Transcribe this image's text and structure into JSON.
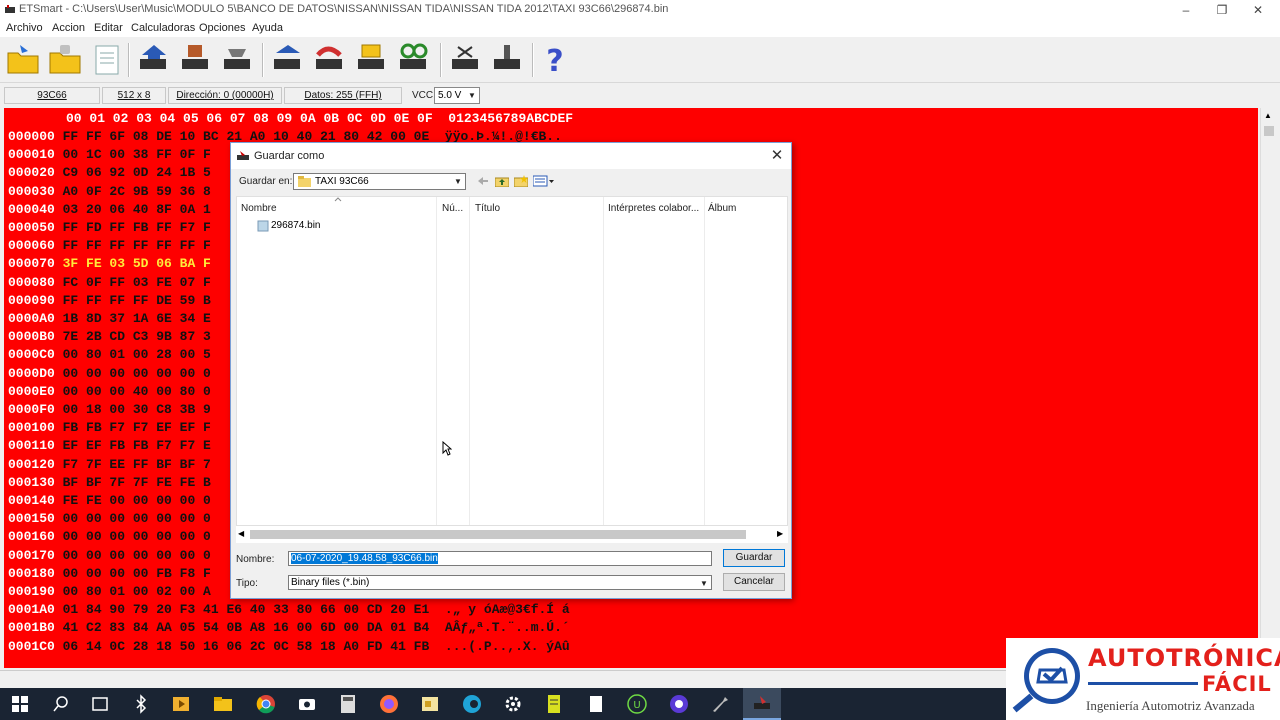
{
  "window": {
    "title": "ETSmart - C:\\Users\\User\\Music\\MODULO 5\\BANCO DE DATOS\\NISSAN\\NISSAN TIDA\\NISSAN TIDA 2012\\TAXI 93C66\\296874.bin"
  },
  "menu": [
    "Archivo",
    "Accion",
    "Editar",
    "Calculadoras",
    "Opciones",
    "Ayuda"
  ],
  "toolbar_icons": [
    "open-icon",
    "open-lock-icon",
    "document-icon",
    "chip-read-icon",
    "chip-write-icon",
    "chip-erase-icon",
    "chip-verify-icon",
    "chip-undo-icon",
    "chip-compare-icon",
    "chip-search-icon",
    "chip-blank-icon",
    "chip-cut-icon",
    "help-icon"
  ],
  "infobar": {
    "chip": "93C66",
    "size": "512 x 8",
    "address": "Dirección: 0 (00000H)",
    "data": "Datos: 255 (FFH)",
    "vcc_label": "VCC",
    "vcc_value": "5.0 V"
  },
  "hex": {
    "header": "00 01 02 03 04 05 06 07 08 09 0A 0B 0C 0D 0E 0F  0123456789ABCDEF",
    "rows": [
      {
        "addr": "000000",
        "bytes": "FF FF 6F 08 DE 10 BC 21 A0 10 40 21 80 42 00 0E  ÿÿo.Þ.¼!.@!€B.."
      },
      {
        "addr": "000010",
        "bytes": "00 1C 00 38 FF 0F F"
      },
      {
        "addr": "000020",
        "bytes": "C9 06 92 0D 24 1B 5"
      },
      {
        "addr": "000030",
        "bytes": "A0 0F 2C 9B 59 36 8"
      },
      {
        "addr": "000040",
        "bytes": "03 20 06 40 8F 0A 1"
      },
      {
        "addr": "000050",
        "bytes": "FF FD FF FB FF F7 F"
      },
      {
        "addr": "000060",
        "bytes": "FF FF FF FF FF FF F"
      },
      {
        "addr": "000070",
        "bytes": "3F FE 03 5D 06 BA F"
      },
      {
        "addr": "000080",
        "bytes": "FC 0F FF 03 FE 07 F"
      },
      {
        "addr": "000090",
        "bytes": "FF FF FF FF DE 59 B"
      },
      {
        "addr": "0000A0",
        "bytes": "1B 8D 37 1A 6E 34 E"
      },
      {
        "addr": "0000B0",
        "bytes": "7E 2B CD C3 9B 87 3"
      },
      {
        "addr": "0000C0",
        "bytes": "00 80 01 00 28 00 5"
      },
      {
        "addr": "0000D0",
        "bytes": "00 00 00 00 00 00 0"
      },
      {
        "addr": "0000E0",
        "bytes": "00 00 00 40 00 80 0"
      },
      {
        "addr": "0000F0",
        "bytes": "00 18 00 30 C8 3B 9"
      },
      {
        "addr": "000100",
        "bytes": "FB FB F7 F7 EF EF F"
      },
      {
        "addr": "000110",
        "bytes": "EF EF FB FB F7 F7 E"
      },
      {
        "addr": "000120",
        "bytes": "F7 7F EE FF BF BF 7"
      },
      {
        "addr": "000130",
        "bytes": "BF BF 7F 7F FE FE B"
      },
      {
        "addr": "000140",
        "bytes": "FE FE 00 00 00 00 0"
      },
      {
        "addr": "000150",
        "bytes": "00 00 00 00 00 00 0"
      },
      {
        "addr": "000160",
        "bytes": "00 00 00 00 00 00 0"
      },
      {
        "addr": "000170",
        "bytes": "00 00 00 00 00 00 0"
      },
      {
        "addr": "000180",
        "bytes": "00 00 00 00 FB F8 F"
      },
      {
        "addr": "000190",
        "bytes": "00 80 01 00 02 00 A"
      },
      {
        "addr": "0001A0",
        "bytes": "01 84 90 79 20 F3 41 E6 40 33 80 66 00 CD 20 E1  .„ y óAæ@3€f.Í á"
      },
      {
        "addr": "0001B0",
        "bytes": "41 C2 83 84 AA 05 54 0B A8 16 00 6D 00 DA 01 B4  AÂƒ„ª.T.¨..m.Ú.´"
      },
      {
        "addr": "0001C0",
        "bytes": "06 14 0C 28 18 50 16 06 2C 0C 58 18 A0 FD 41 FB  ...(.P..,.X. ýAû"
      }
    ]
  },
  "dialog": {
    "title": "Guardar como",
    "save_in_label": "Guardar en:",
    "save_in_value": "TAXI 93C66",
    "columns": [
      "Nombre",
      "Nú...",
      "Título",
      "Intérpretes colabor...",
      "Álbum"
    ],
    "files": [
      {
        "name": "296874.bin"
      }
    ],
    "name_label": "Nombre:",
    "name_value": "06-07-2020_19.48.58_93C66.bin",
    "type_label": "Tipo:",
    "type_value": "Binary files (*.bin)",
    "save_button": "Guardar",
    "cancel_button": "Cancelar"
  },
  "logo": {
    "line1": "AUTOTRÓNICA",
    "line2": "FÁCIL",
    "tagline": "Ingeniería Automotriz Avanzada"
  },
  "taskbar_icons": [
    "windows-start-icon",
    "search-icon",
    "task-view-icon",
    "bluetooth-icon",
    "media-player-icon",
    "file-explorer-icon",
    "chrome-icon",
    "camera-icon",
    "calculator-icon",
    "firefox-icon",
    "folder-icon",
    "edge-icon",
    "settings-icon",
    "notes-icon",
    "document-icon",
    "upwork-icon",
    "browser-icon",
    "tool-icon",
    "etsmart-icon"
  ],
  "colors": {
    "hex_background": "#fe0000",
    "highlight_bytes": "#ffeb3b",
    "selection": "#0078d7",
    "brand_red": "#e3201b"
  }
}
